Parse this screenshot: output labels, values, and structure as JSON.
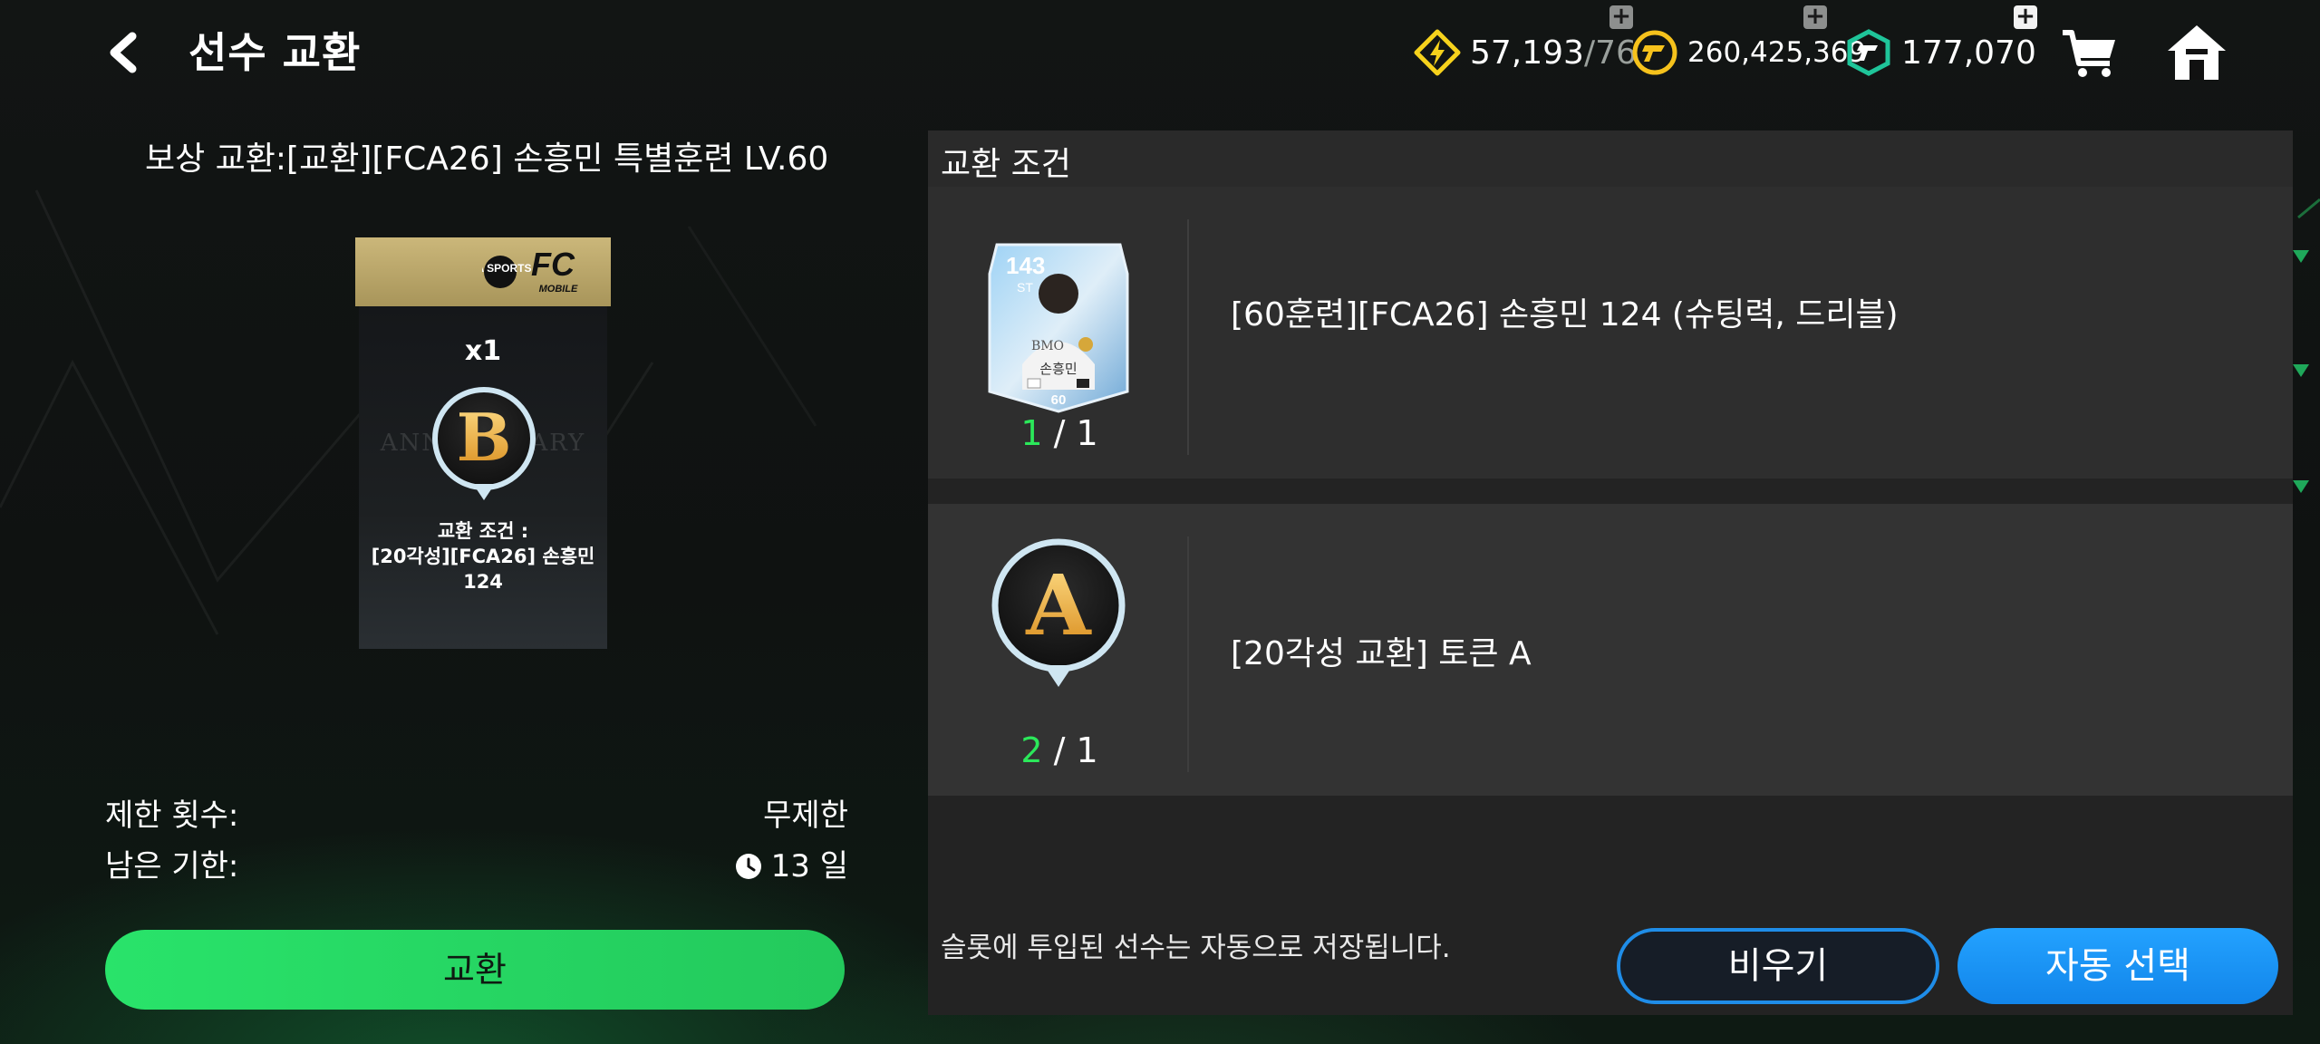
{
  "header": {
    "title": "선수 교환",
    "currencies": [
      {
        "icon": "energy-icon",
        "amount": "57,193",
        "max": "/76"
      },
      {
        "icon": "coin-icon",
        "amount": "260,425,369"
      },
      {
        "icon": "fc-points-icon",
        "amount": "177,070"
      }
    ]
  },
  "reward": {
    "title": "보상 교환:[교환][FCA26] 손흥민 특별훈련 LV.60",
    "pack": {
      "count": "x1",
      "token_letter": "B",
      "condition_line1": "교환 조건 :",
      "condition_line2": "[20각성][FCA26] 손흥민 124",
      "brand": "FC",
      "brand_sub": "MOBILE",
      "ea": "EA SPORTS",
      "watermark": "ANNIVERSARY"
    },
    "limit_label": "제한 횟수:",
    "limit_value": "무제한",
    "remaining_label": "남은 기한:",
    "remaining_value": "13 일",
    "exchange_button": "교환"
  },
  "conditions": {
    "title": "교환 조건",
    "items": [
      {
        "label": "[60훈련][FCA26] 손흥민 124 (슈팅력, 드리블)",
        "have": "1",
        "need": " / 1",
        "card": {
          "ovr": "143",
          "pos": "ST",
          "name": "손흥민",
          "level": "60",
          "sponsor": "BMO"
        }
      },
      {
        "label": "[20각성 교환] 토큰 A",
        "have": "2",
        "need": " / 1",
        "token_letter": "A"
      }
    ],
    "note": "슬롯에 투입된 선수는 자동으로 저장됩니다.",
    "clear_button": "비우기",
    "auto_button": "자동 선택"
  },
  "colors": {
    "accent_green": "#2be85a",
    "accent_blue": "#1f8de8",
    "gold": "#f6c21c"
  }
}
